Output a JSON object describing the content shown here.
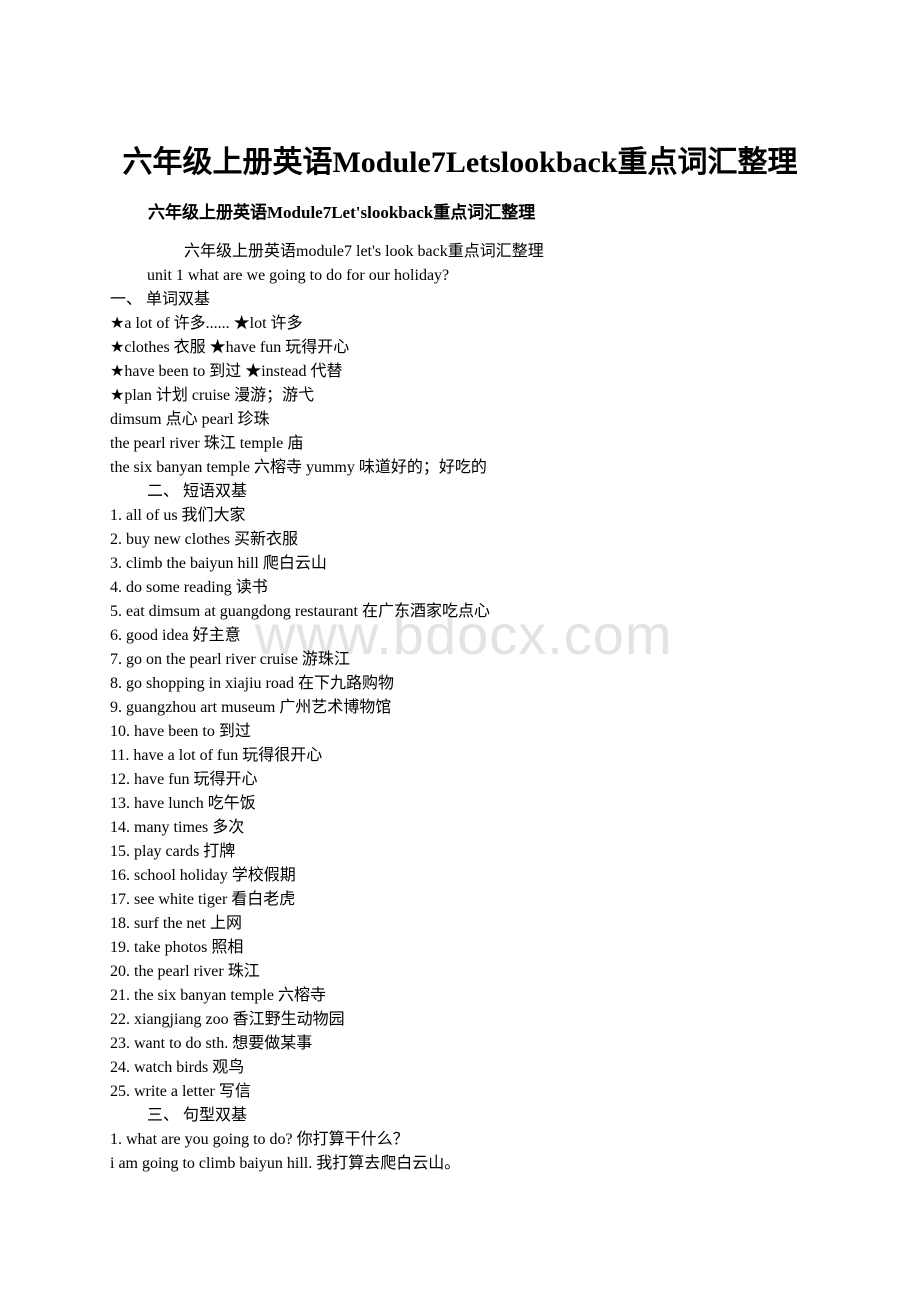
{
  "document": {
    "title": "六年级上册英语Module7Letslookback重点词汇整理",
    "subtitle": "六年级上册英语Module7Let'slookback重点词汇整理",
    "watermark": "www.bdocx.com",
    "intro_heading": "六年级上册英语module7 let's look back重点词汇整理",
    "unit_heading": "unit 1 what are we going to do for our holiday?",
    "sections": [
      {
        "heading": "一、 单词双基",
        "lines": [
          "★a lot of 许多...... ★lot 许多",
          "★clothes 衣服 ★have fun 玩得开心",
          "★have been to 到过 ★instead 代替",
          "★plan 计划 cruise 漫游；游弋",
          "dimsum 点心 pearl 珍珠",
          "the pearl river 珠江 temple 庙",
          "the six banyan temple 六榕寺 yummy 味道好的；好吃的"
        ]
      },
      {
        "heading": "二、 短语双基",
        "lines": [
          "1. all of us 我们大家",
          "2. buy new clothes 买新衣服",
          "3. climb the baiyun hill 爬白云山",
          "4. do some reading 读书",
          "5. eat dimsum at guangdong restaurant 在广东酒家吃点心",
          "6. good idea 好主意",
          "7. go on the pearl river cruise 游珠江",
          "8. go shopping in xiajiu road 在下九路购物",
          "9. guangzhou art museum 广州艺术博物馆",
          "10. have been to 到过",
          "11. have a lot of fun 玩得很开心",
          "12. have fun 玩得开心",
          "13. have lunch 吃午饭",
          "14. many times 多次",
          "15. play cards 打牌",
          "16. school holiday 学校假期",
          "17. see white tiger 看白老虎",
          "18. surf the net 上网",
          "19. take photos 照相",
          "20. the pearl river 珠江",
          "21. the six banyan temple 六榕寺",
          "22. xiangjiang zoo 香江野生动物园",
          "23. want to do sth. 想要做某事",
          "24. watch birds 观鸟",
          "25. write a letter 写信"
        ]
      },
      {
        "heading": "三、 句型双基",
        "lines": [
          "1. what are you going to do? 你打算干什么？",
          "i am going to climb baiyun hill. 我打算去爬白云山。"
        ]
      }
    ]
  }
}
